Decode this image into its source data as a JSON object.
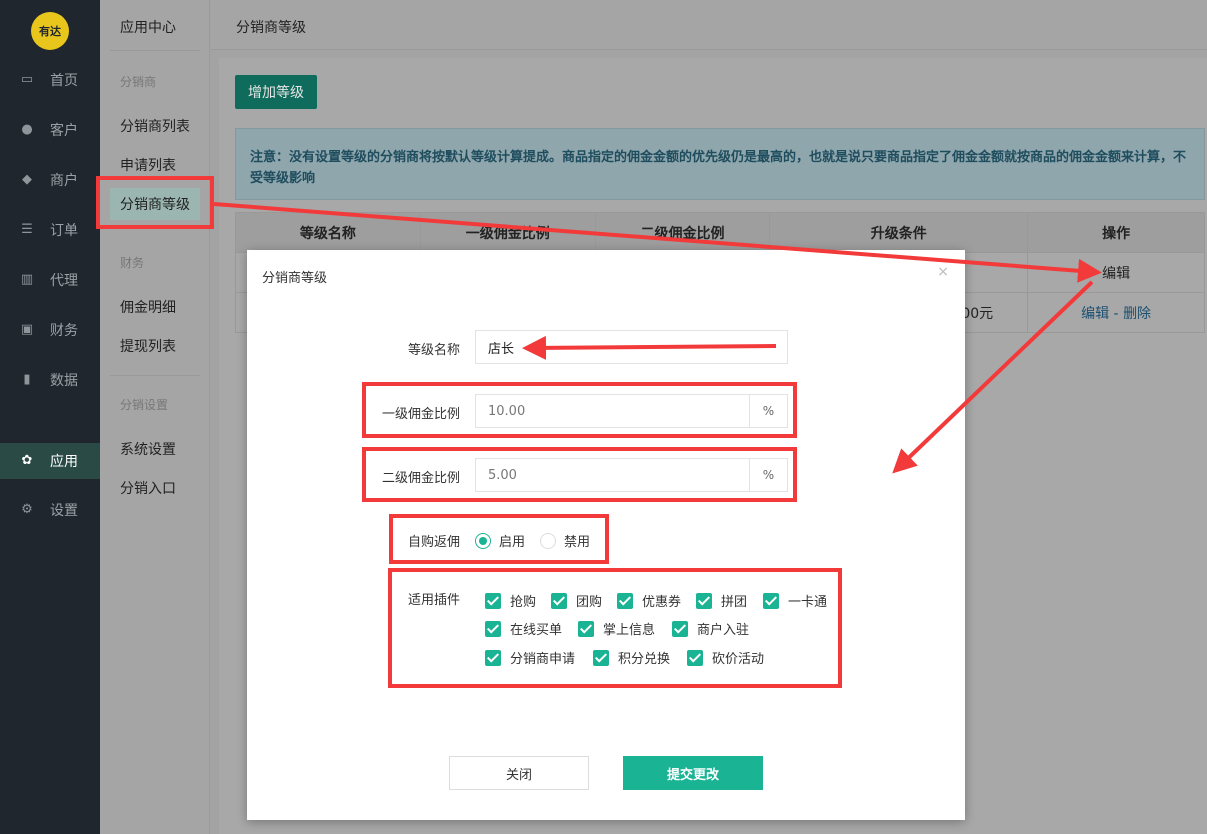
{
  "logo_text": "有达",
  "nav": {
    "items": [
      {
        "label": "首页",
        "icon": "monitor-icon"
      },
      {
        "label": "客户",
        "icon": "user-icon"
      },
      {
        "label": "商户",
        "icon": "users-icon"
      },
      {
        "label": "订单",
        "icon": "list-icon"
      },
      {
        "label": "代理",
        "icon": "map-icon"
      },
      {
        "label": "财务",
        "icon": "money-icon"
      },
      {
        "label": "数据",
        "icon": "bar-chart-icon"
      },
      {
        "label": "应用",
        "icon": "apps-icon",
        "active": true
      },
      {
        "label": "设置",
        "icon": "gear-icon"
      }
    ]
  },
  "sidebar": {
    "title": "应用中心",
    "group1": "分销商",
    "item_list": "分销商列表",
    "item_apply": "申请列表",
    "item_level": "分销商等级",
    "group2": "财务",
    "item_commission": "佣金明细",
    "item_withdraw": "提现列表",
    "group3": "分销设置",
    "item_settings": "系统设置",
    "item_entry": "分销入口"
  },
  "header": {
    "title": "分销商等级"
  },
  "add_button": "增加等级",
  "notice": "注意：没有设置等级的分销商将按默认等级计算提成。商品指定的佣金金额的优先级仍是最高的，也就是说只要商品指定了佣金金额就按商品的佣金金额来计算，不受等级影响",
  "table": {
    "headers": [
      "等级名称",
      "一级佣金比例",
      "二级佣金比例",
      "升级条件",
      "操作"
    ],
    "row1_action": "编辑",
    "row2_condition_tail": "00元",
    "row2_edit": "编辑",
    "row2_sep": " - ",
    "row2_delete": "删除"
  },
  "modal": {
    "title": "分销商等级",
    "close_symbol": "×",
    "level_name_label": "等级名称",
    "level_name_value": "店长",
    "rate1_label": "一级佣金比例",
    "rate1_value": "10.00",
    "rate2_label": "二级佣金比例",
    "rate2_value": "5.00",
    "percent": "%",
    "self_buy_label": "自购返佣",
    "enable_label": "启用",
    "disable_label": "禁用",
    "self_buy_enabled": true,
    "plugins_label": "适用插件",
    "plugins": [
      "抢购",
      "团购",
      "优惠券",
      "拼团",
      "一卡通",
      "在线买单",
      "掌上信息",
      "商户入驻",
      "分销商申请",
      "积分兑换",
      "砍价活动"
    ],
    "close_button": "关闭",
    "submit_button": "提交更改"
  },
  "colors": {
    "accent": "#1ab394",
    "annotation_red": "#f23a3a",
    "nav_bg": "#1f262d"
  }
}
